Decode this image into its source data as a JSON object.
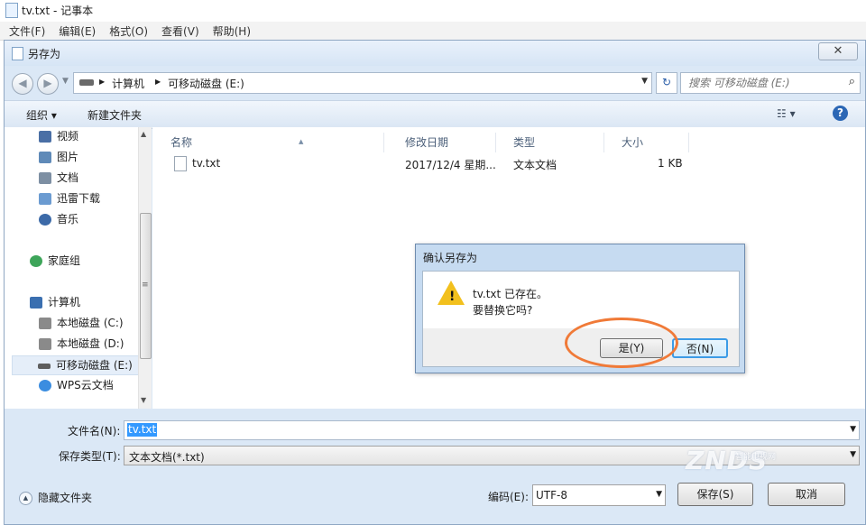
{
  "notepad": {
    "title": "tv.txt - 记事本",
    "menu": [
      "文件(F)",
      "编辑(E)",
      "格式(O)",
      "查看(V)",
      "帮助(H)"
    ]
  },
  "save_dialog": {
    "title": "另存为",
    "close_label": "✕",
    "address": {
      "segments": [
        "计算机",
        "可移动磁盘 (E:)"
      ]
    },
    "search": {
      "placeholder": "搜索 可移动磁盘 (E:)"
    },
    "toolbar": {
      "organize": "组织 ▾",
      "new_folder": "新建文件夹",
      "help": "?"
    },
    "nav": [
      {
        "label": "视频",
        "icon": "video-library-icon",
        "color": "#4a6fa5"
      },
      {
        "label": "图片",
        "icon": "pictures-library-icon",
        "color": "#5f8ab8"
      },
      {
        "label": "文档",
        "icon": "documents-library-icon",
        "color": "#7d8fa3"
      },
      {
        "label": "迅雷下载",
        "icon": "download-folder-icon",
        "color": "#6b9bd1"
      },
      {
        "label": "音乐",
        "icon": "music-library-icon",
        "color": "#3c6aa8"
      },
      {
        "label": "家庭组",
        "icon": "homegroup-icon",
        "color": "#3ea55a"
      },
      {
        "label": "计算机",
        "icon": "computer-icon",
        "color": "#3a6fb0"
      },
      {
        "label": "本地磁盘 (C:)",
        "icon": "local-disk-icon",
        "color": "#8a8a8a"
      },
      {
        "label": "本地磁盘 (D:)",
        "icon": "local-disk-icon",
        "color": "#8a8a8a"
      },
      {
        "label": "可移动磁盘 (E:)",
        "icon": "removable-disk-icon",
        "color": "#5e5e5e"
      },
      {
        "label": "WPS云文档",
        "icon": "wps-cloud-icon",
        "color": "#3b8de0"
      }
    ],
    "columns": [
      "名称",
      "修改日期",
      "类型",
      "大小"
    ],
    "files": [
      {
        "name": "tv.txt",
        "modified": "2017/12/4 星期...",
        "type": "文本文档",
        "size": "1 KB"
      }
    ],
    "filename_label": "文件名(N):",
    "filename_value": "tv.txt",
    "filetype_label": "保存类型(T):",
    "filetype_value": "文本文档(*.txt)",
    "hide_folders": "隐藏文件夹",
    "encoding_label": "编码(E):",
    "encoding_value": "UTF-8",
    "save_button": "保存(S)",
    "cancel_button": "取消"
  },
  "confirm_dialog": {
    "title": "确认另存为",
    "message_line1": "tv.txt 已存在。",
    "message_line2": "要替换它吗?",
    "yes_button": "是(Y)",
    "no_button": "否(N)"
  },
  "watermark": {
    "logo": "ZNDS",
    "subtitle": "智能电视网"
  }
}
